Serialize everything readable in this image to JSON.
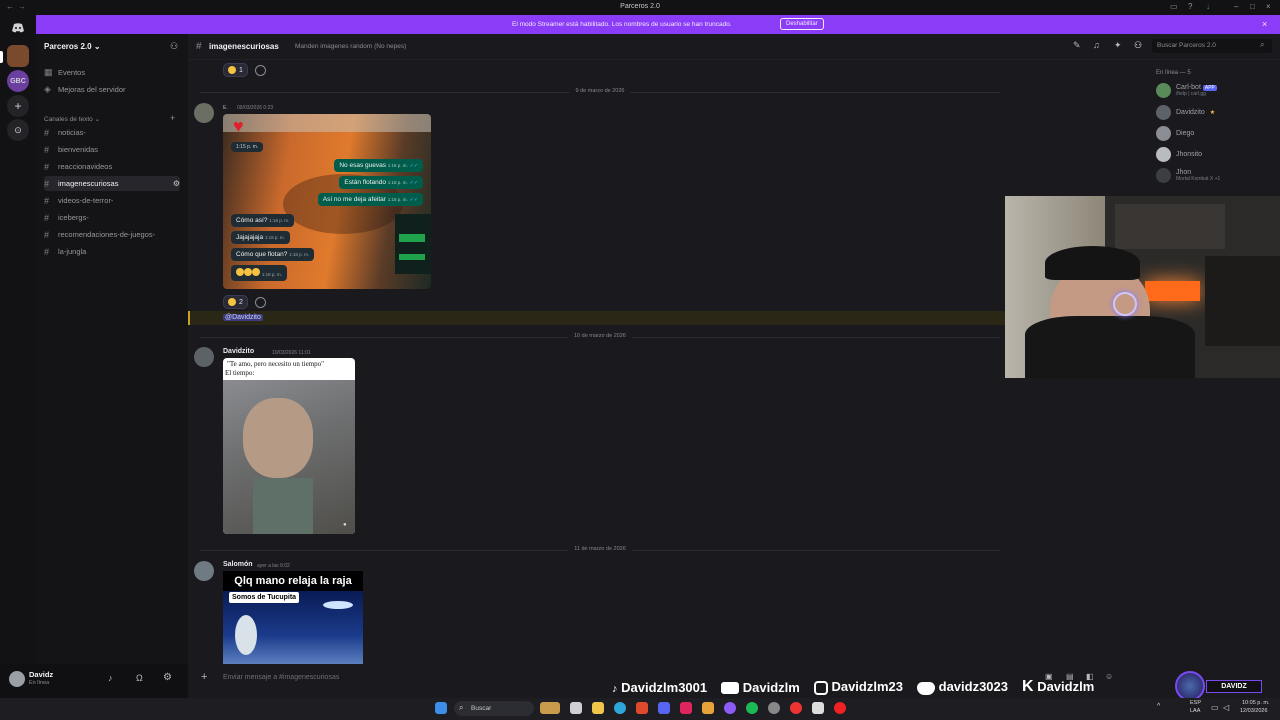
{
  "window": {
    "title": "Parceros 2.0"
  },
  "banner": {
    "text": "El modo Streamer está habilitado. Los nombres de usuario se han truncado.",
    "button": "Deshabilitar"
  },
  "sidebar": {
    "server_name": "Parceros 2.0",
    "top_items": [
      {
        "label": "Eventos"
      },
      {
        "label": "Mejoras del servidor"
      }
    ],
    "category": "Canales de texto",
    "channels": [
      {
        "label": "noticias-"
      },
      {
        "label": "bienvenidas"
      },
      {
        "label": "reaccionavideos"
      },
      {
        "label": "imagenescuriosas"
      },
      {
        "label": "videos-de-terror-"
      },
      {
        "label": "icebergs-"
      },
      {
        "label": "recomendaciones-de-juegos-"
      },
      {
        "label": "la-jungla"
      }
    ]
  },
  "header": {
    "channel": "imagenescuriosas",
    "topic": "Manden imagenes random (No nepes)",
    "search_placeholder": "Buscar Parceros 2.0"
  },
  "messages": {
    "reaction_top": {
      "count": "1"
    },
    "date_1": "9 de marzo de 2026",
    "msg1": {
      "author": "E.",
      "timestamp": "09/03/2026 0:23",
      "reaction_count": "2",
      "mention": "@Davidzito"
    },
    "chat_image": {
      "time_top": "1:15 p. m.",
      "bubbles_right": [
        {
          "text": "No esas guevas",
          "time": "1:18 p. m."
        },
        {
          "text": "Están flotando",
          "time": "1:18 p. m."
        },
        {
          "text": "Así no me deja afeitar",
          "time": "1:18 p. m."
        }
      ],
      "bubbles_left": [
        {
          "text": "Cómo así?",
          "time": "1:18 p. m."
        },
        {
          "text": "Jajajajaja",
          "time": "1:18 p. m."
        },
        {
          "text": "Cómo que flotan?",
          "time": "1:18 p. m."
        },
        {
          "text": "",
          "time": "1:18 p. m."
        }
      ]
    },
    "date_2": "10 de marzo de 2026",
    "msg2": {
      "author": "Davidzito",
      "timestamp": "10/03/2026 11:01",
      "caption_line1": "\"Te amo, pero necesito un tiempo\"",
      "caption_line2": "El tiempo:"
    },
    "date_3": "11 de marzo de 2026",
    "msg3": {
      "author": "Salomón",
      "timestamp": "ayer a las 6:02",
      "meme_title": "Qlq mano relaja la raja",
      "meme_sub": "Somos de Tucupita"
    }
  },
  "members": {
    "heading": "En línea — 5",
    "list": [
      {
        "name": "Carl-bot",
        "badge": "APP",
        "status": "/help | carl.gg"
      },
      {
        "name": "Davidzito",
        "status": ""
      },
      {
        "name": "Diego",
        "status": ""
      },
      {
        "name": "Jhonsito",
        "status": ""
      },
      {
        "name": "Jhon",
        "status": "Mortal Kombat X +1"
      }
    ]
  },
  "composer": {
    "placeholder": "Enviar mensaje a #imagenescuriosas"
  },
  "userbar": {
    "name": "Davidz",
    "status": "En línea"
  },
  "overlay": {
    "tiktok": "Davidzlm3001",
    "youtube": "Davidzlm",
    "instagram": "Davidzlm23",
    "discord": "davidz3023",
    "kick": "Davidzlm",
    "logo": "DAVIDZ"
  },
  "taskbar": {
    "search": "Buscar",
    "lang": "ESP",
    "lang2": "LAA",
    "time": "10:05 p. m.",
    "date": "12/03/2026"
  },
  "colors": {
    "accent": "#8b3cf7",
    "bg": "#1a1a1e",
    "sidebar": "#141417",
    "online": "#23a55a"
  }
}
